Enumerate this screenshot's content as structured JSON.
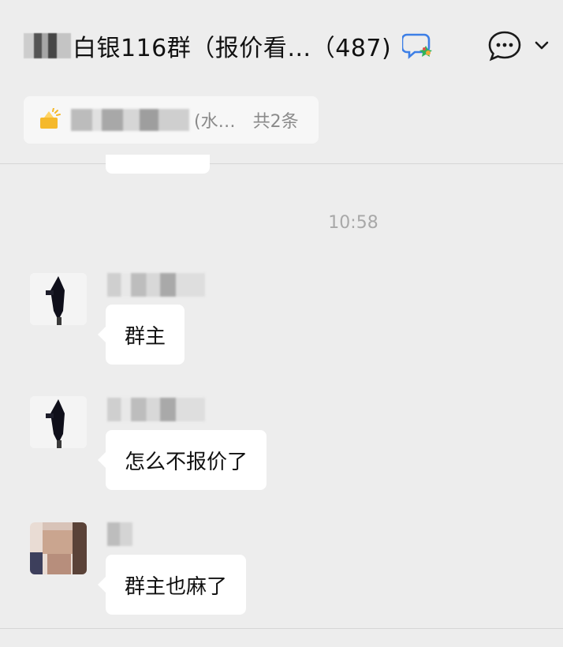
{
  "header": {
    "title": "白银116群（报价看…（487)",
    "badge_icon": "group-chat-badge-icon",
    "menu_icon": "chat-bubble-icon",
    "dropdown_icon": "chevron-down-icon"
  },
  "pinned": {
    "text": "(水…",
    "count": "共2条",
    "icon": "pinned-notice-icon"
  },
  "timestamp": "10:58",
  "messages": [
    {
      "text": "群主"
    },
    {
      "text": "怎么不报价了"
    },
    {
      "text": "群主也麻了"
    }
  ],
  "colors": {
    "background": "#ededed",
    "bubble": "#ffffff",
    "meta_text": "#a8a8a8"
  }
}
